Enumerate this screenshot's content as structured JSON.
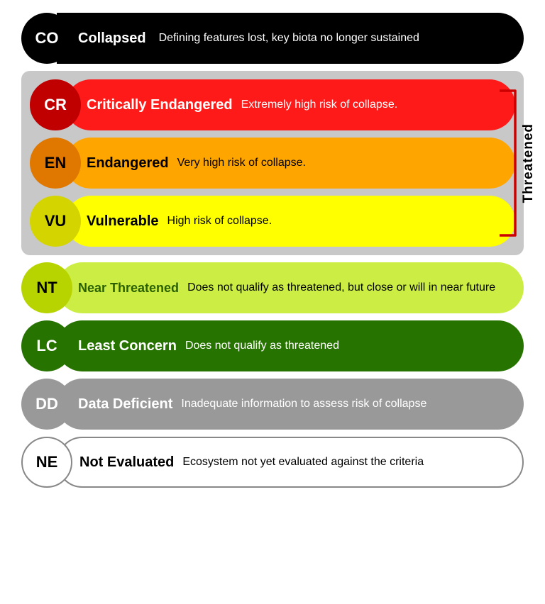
{
  "rows": {
    "collapsed": {
      "code": "CO",
      "label": "Collapsed",
      "description": "Defining features lost, key biota no longer sustained",
      "circle_bg": "#000000",
      "circle_text_color": "#ffffff",
      "pill_bg": "#000000",
      "pill_text_color": "#ffffff",
      "desc_color": "#ffffff"
    },
    "threatened_section_label": "Threatened",
    "cr": {
      "code": "CR",
      "label": "Critically Endangered",
      "description": "Extremely high risk of collapse.",
      "circle_bg": "#e00000",
      "circle_text_color": "#ffffff",
      "pill_bg": "#ff0000",
      "label_color": "#ffffff",
      "desc_color": "#ffffff"
    },
    "en": {
      "code": "EN",
      "label": "Endangered",
      "description": "Very high risk of collapse.",
      "circle_bg": "#ff8c00",
      "circle_text_color": "#000000",
      "pill_bg": "#ffa500",
      "label_color": "#000000",
      "desc_color": "#000000"
    },
    "vu": {
      "code": "VU",
      "label": "Vulnerable",
      "description": "High risk of collapse.",
      "circle_bg": "#e6e600",
      "circle_text_color": "#000000",
      "pill_bg": "#ffff00",
      "label_color": "#000000",
      "desc_color": "#000000"
    },
    "nt": {
      "code": "NT",
      "label": "Near Threatened",
      "description": "Does not qualify as threatened, but close or will in near future",
      "circle_bg": "#b2d600",
      "circle_text_color": "#000000",
      "pill_bg": "#c8e640",
      "label_color": "#2d6600",
      "desc_color": "#000000"
    },
    "lc": {
      "code": "LC",
      "label": "Least Concern",
      "description": "Does not qualify as threatened",
      "circle_bg": "#2d8000",
      "circle_text_color": "#ffffff",
      "pill_bg": "#2d8000",
      "label_color": "#ffffff",
      "desc_color": "#ffffff"
    },
    "dd": {
      "code": "DD",
      "label": "Data Deficient",
      "description": "Inadequate information to assess risk of collapse",
      "circle_bg": "#999999",
      "circle_text_color": "#ffffff",
      "pill_bg": "#999999",
      "label_color": "#ffffff",
      "desc_color": "#ffffff"
    },
    "ne": {
      "code": "NE",
      "label": "Not Evaluated",
      "description": "Ecosystem not yet evaluated against the criteria",
      "circle_bg": "#ffffff",
      "circle_text_color": "#000000",
      "pill_bg": "#ffffff",
      "label_color": "#000000",
      "desc_color": "#000000"
    }
  }
}
